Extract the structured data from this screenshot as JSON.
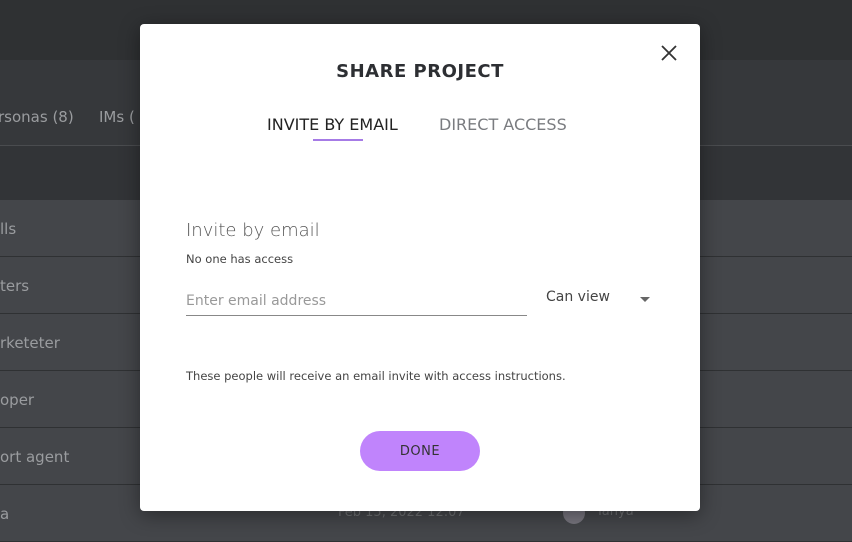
{
  "background": {
    "tabs": [
      "rsonas (8)",
      "IMs ("
    ],
    "rows": [
      {
        "label": "lls"
      },
      {
        "label": "ters"
      },
      {
        "label": "rketeter"
      },
      {
        "label": "oper"
      },
      {
        "label": "ort agent"
      },
      {
        "label": "a",
        "date": "Feb 15, 2022 12:07",
        "user": "Tanya"
      }
    ]
  },
  "modal": {
    "title": "SHARE PROJECT",
    "tabs": [
      {
        "label": "INVITE BY EMAIL",
        "active": true
      },
      {
        "label": "DIRECT ACCESS",
        "active": false
      }
    ],
    "heading": "Invite by email",
    "access_status": "No one has access",
    "email_placeholder": "Enter email address",
    "email_value": "",
    "permission": "Can view",
    "note": "These people will receive an email invite with access instructions.",
    "done_label": "DONE",
    "accent": "#c084fc",
    "close_icon": "close-icon"
  }
}
